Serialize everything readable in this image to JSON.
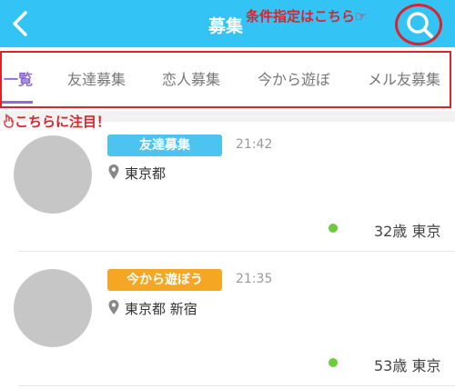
{
  "header": {
    "title": "募集",
    "back_icon": "chevron-left-icon",
    "search_icon": "search-icon",
    "color": "#34c3f5"
  },
  "annotations": {
    "search_hint": "条件指定はこちら☞",
    "tab_hint": "こちらに注目！",
    "tab_hint_icon": "pointing-hand-icon",
    "highlight_color": "#d9242b"
  },
  "tabs": [
    {
      "label": "一覧",
      "active": true
    },
    {
      "label": "友達募集",
      "active": false
    },
    {
      "label": "恋人募集",
      "active": false
    },
    {
      "label": "今から遊ぼ",
      "active": false
    },
    {
      "label": "メル友募集",
      "active": false
    }
  ],
  "posts": [
    {
      "category": "友達募集",
      "category_color": "#4dc3ef",
      "time": "21:42",
      "location": "東京都",
      "online": true,
      "age_area": "32歳 東京"
    },
    {
      "category": "今から遊ぼう",
      "category_color": "#f5a623",
      "time": "21:35",
      "location": "東京都 新宿",
      "online": true,
      "age_area": "53歳 東京"
    }
  ]
}
